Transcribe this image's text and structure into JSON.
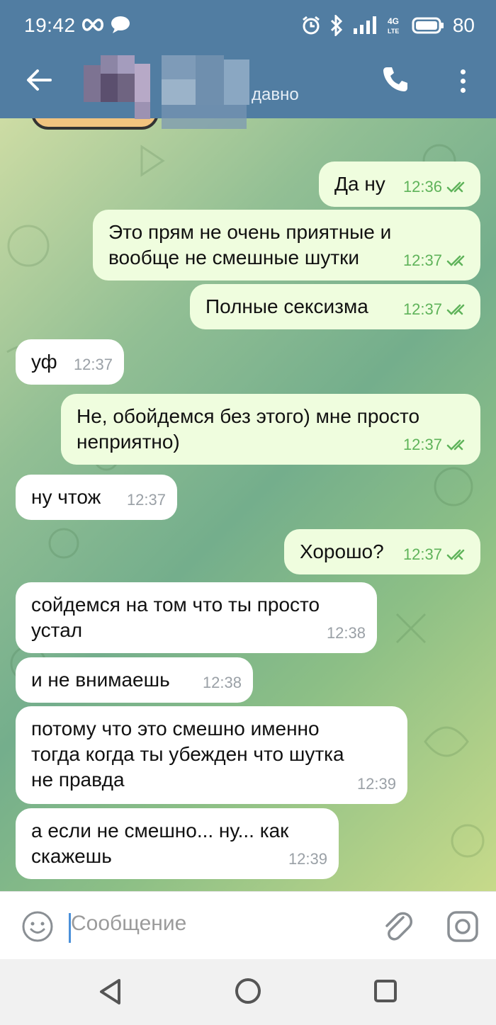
{
  "status_bar": {
    "time": "19:42",
    "battery": "80",
    "network": "4G"
  },
  "header": {
    "contact_status": "давно",
    "back_icon": "arrow-left-icon",
    "call_icon": "phone-icon",
    "menu_icon": "more-vertical-icon"
  },
  "colors": {
    "header": "#517da2",
    "outgoing_bubble": "#effdde",
    "incoming_bubble": "#ffffff",
    "read_check": "#5fb35a"
  },
  "messages": [
    {
      "dir": "out",
      "text": "Да ну",
      "time": "12:36"
    },
    {
      "dir": "out",
      "text": "Это прям не очень приятные и\nвообще не смешные шутки",
      "time": "12:37"
    },
    {
      "dir": "out",
      "text": "Полные сексизма",
      "time": "12:37"
    },
    {
      "dir": "in",
      "text": "уф",
      "time": "12:37"
    },
    {
      "dir": "out",
      "text": "Не, обойдемся без этого) мне просто\nнеприятно)",
      "time": "12:37"
    },
    {
      "dir": "in",
      "text": "ну чтож",
      "time": "12:37"
    },
    {
      "dir": "out",
      "text": "Хорошо?",
      "time": "12:37"
    },
    {
      "dir": "in",
      "text": "сойдемся на том что ты просто\nустал",
      "time": "12:38"
    },
    {
      "dir": "in",
      "text": "и не внимаешь",
      "time": "12:38"
    },
    {
      "dir": "in",
      "text": "потому что это смешно именно\nтогда когда ты убежден что шутка\nне правда",
      "time": "12:39"
    },
    {
      "dir": "in",
      "text": "а если не смешно... ну... как\nскажешь",
      "time": "12:39"
    }
  ],
  "input": {
    "placeholder": "Сообщение"
  }
}
